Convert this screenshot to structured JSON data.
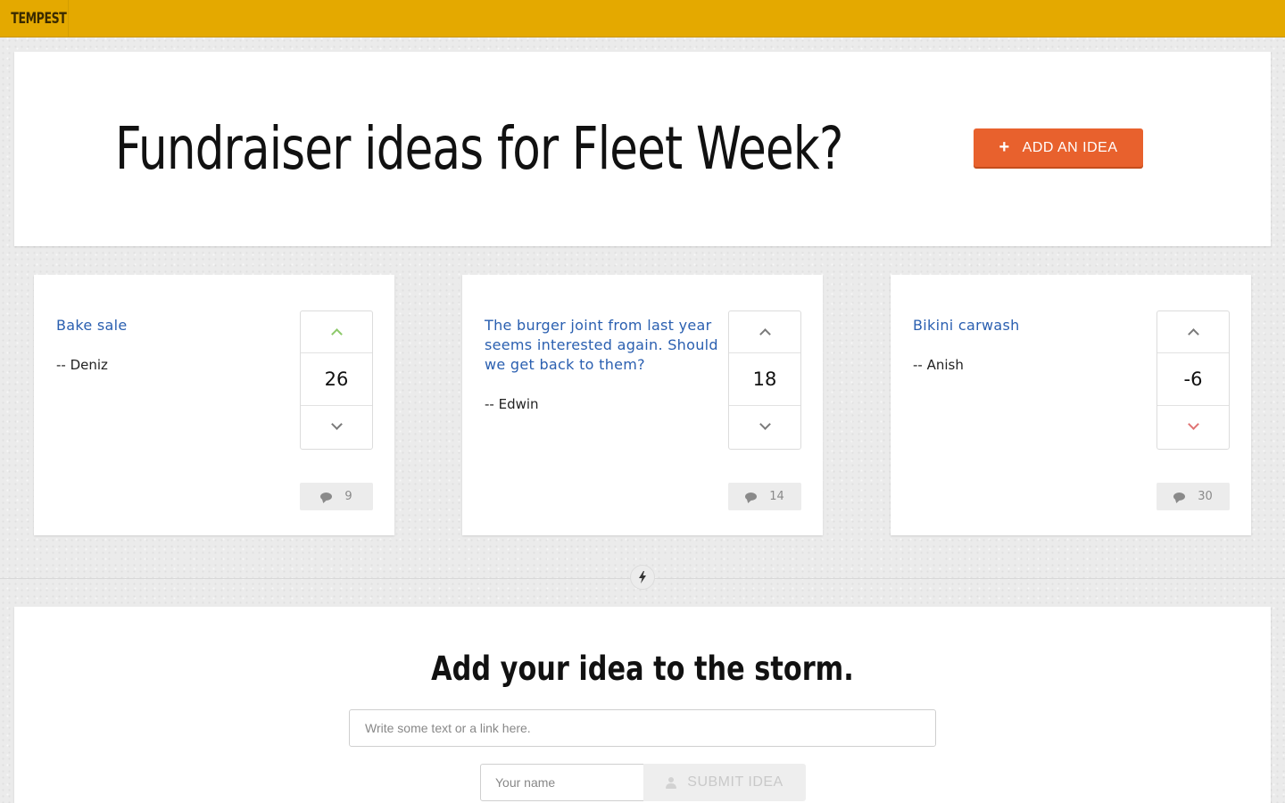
{
  "brand": "TEMPEST",
  "hero": {
    "title": "Fundraiser ideas for Fleet Week?",
    "add_button_label": "ADD AN IDEA",
    "add_button_icon": "+"
  },
  "ideas": [
    {
      "text": "Bake sale",
      "author": "-- Deniz",
      "score": "26",
      "comments": "9",
      "voted": "up"
    },
    {
      "text": "The burger joint from last year seems interested again. Should we get back to them?",
      "author": "-- Edwin",
      "score": "18",
      "comments": "14",
      "voted": "none"
    },
    {
      "text": "Bikini carwash",
      "author": "-- Anish",
      "score": "-6",
      "comments": "30",
      "voted": "down"
    }
  ],
  "colors": {
    "topbar": "#e4a900",
    "accent_button": "#e8612d",
    "idea_text": "#2a5fb0",
    "upvote_active": "#8dc96a",
    "downvote_active": "#e07373",
    "vote_neutral": "#7a7a7a"
  },
  "submit": {
    "title": "Add your idea to the storm.",
    "idea_placeholder": "Write some text or a link here.",
    "name_placeholder": "Your name",
    "button_label": "SUBMIT IDEA"
  },
  "divider_icon": "lightning-bolt"
}
